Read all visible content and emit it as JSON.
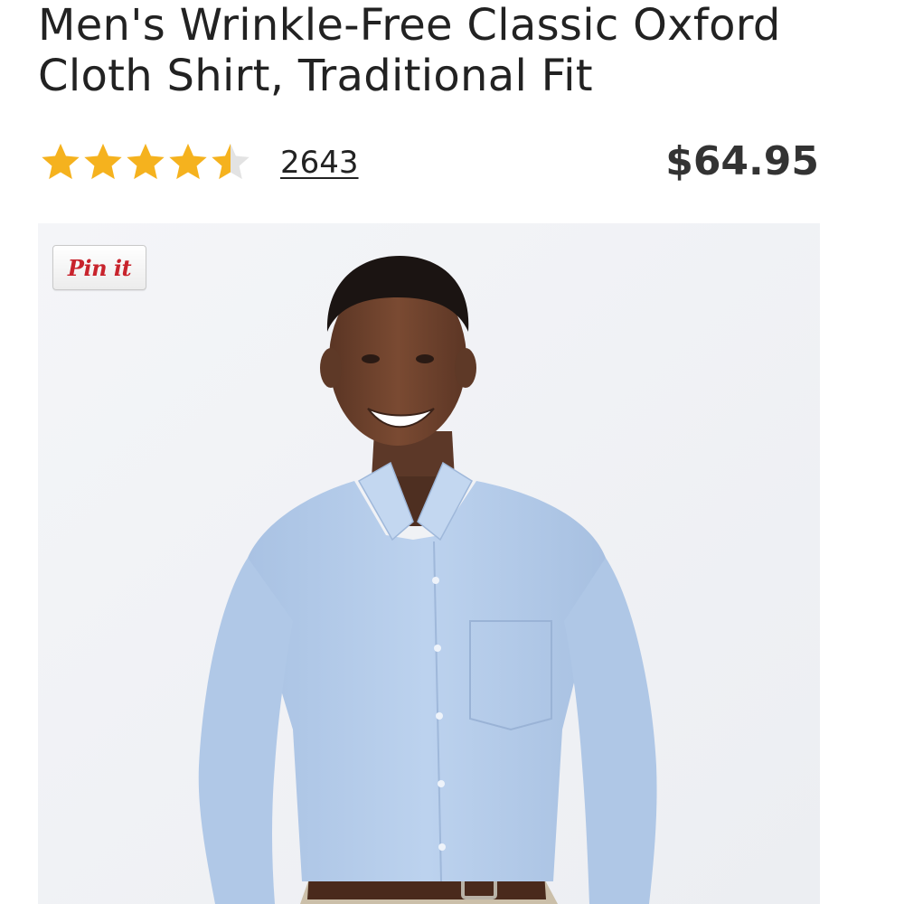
{
  "product": {
    "title": "Men's Wrinkle-Free Classic Oxford Cloth Shirt, Traditional Fit",
    "rating": 4.5,
    "rating_max": 5,
    "review_count": "2643",
    "price": "$64.95"
  },
  "image": {
    "alt": "Smiling man wearing a light blue oxford cloth button-down shirt",
    "pin_button_label": "Pin it"
  },
  "colors": {
    "star_fill": "#F5B21E",
    "star_empty": "#E3E3E3",
    "text": "#222222",
    "price": "#333333",
    "pin_red": "#C8232C",
    "shirt": "#B5CDEB",
    "image_background": "#F1F3F6"
  },
  "icons": {
    "star": "star-icon",
    "half_star": "half-star-icon"
  }
}
